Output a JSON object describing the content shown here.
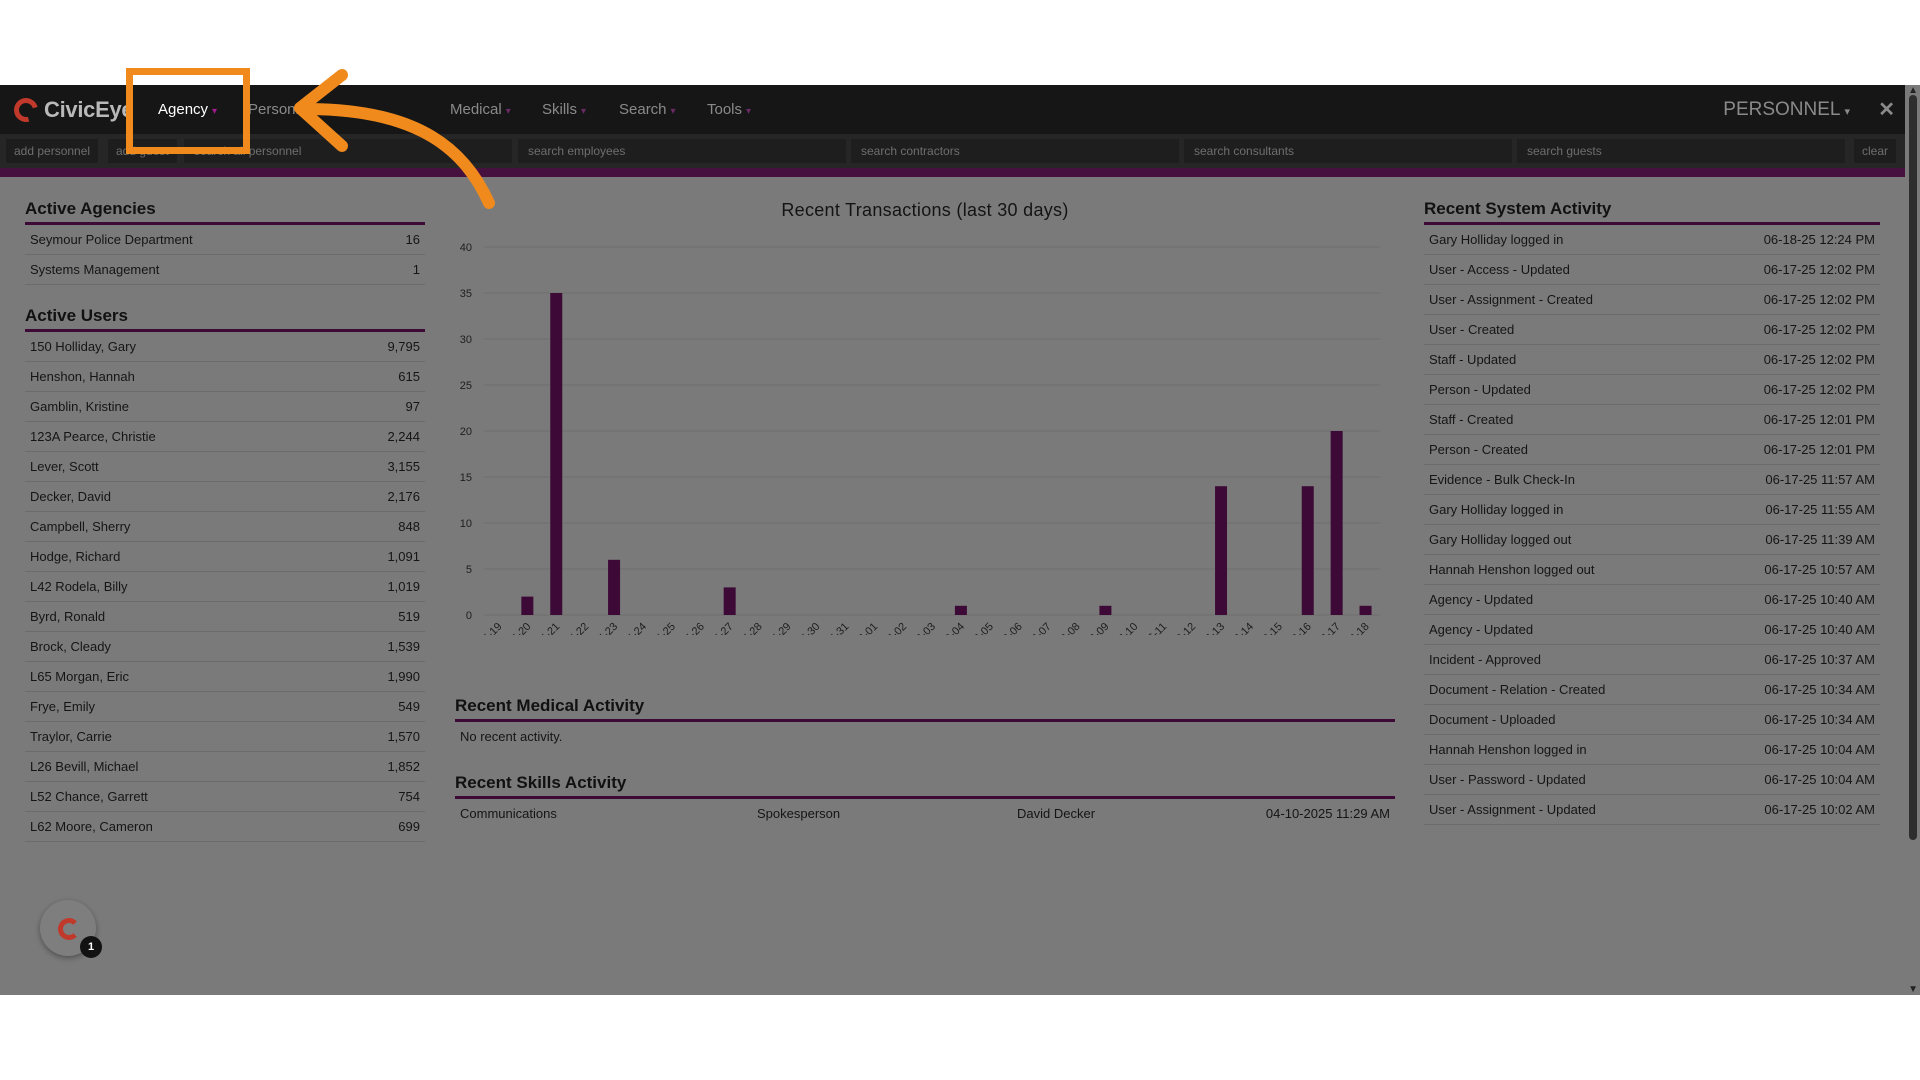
{
  "nav": {
    "brand": "CivicEye",
    "menus": [
      "Agency",
      "Personnel",
      "Medical",
      "Skills",
      "Search",
      "Tools"
    ],
    "persona": "PERSONNEL"
  },
  "searchbar": {
    "add_personnel": "add personnel",
    "add_guest": "add guest",
    "fields": [
      "search all personnel",
      "search employees",
      "search contractors",
      "search consultants",
      "search guests"
    ],
    "clear": "clear"
  },
  "active_agencies": {
    "title": "Active Agencies",
    "rows": [
      {
        "name": "Seymour Police Department",
        "count": "16"
      },
      {
        "name": "Systems Management",
        "count": "1"
      }
    ]
  },
  "active_users": {
    "title": "Active Users",
    "rows": [
      {
        "name": "150 Holliday, Gary",
        "count": "9,795"
      },
      {
        "name": "Henshon, Hannah",
        "count": "615"
      },
      {
        "name": "Gamblin, Kristine",
        "count": "97"
      },
      {
        "name": "123A Pearce, Christie",
        "count": "2,244"
      },
      {
        "name": "Lever, Scott",
        "count": "3,155"
      },
      {
        "name": "Decker, David",
        "count": "2,176"
      },
      {
        "name": "Campbell, Sherry",
        "count": "848"
      },
      {
        "name": "Hodge, Richard",
        "count": "1,091"
      },
      {
        "name": "L42 Rodela, Billy",
        "count": "1,019"
      },
      {
        "name": "Byrd, Ronald",
        "count": "519"
      },
      {
        "name": "Brock, Cleady",
        "count": "1,539"
      },
      {
        "name": "L65 Morgan, Eric",
        "count": "1,990"
      },
      {
        "name": "Frye, Emily",
        "count": "549"
      },
      {
        "name": "Traylor, Carrie",
        "count": "1,570"
      },
      {
        "name": "L26 Bevill, Michael",
        "count": "1,852"
      },
      {
        "name": "L52 Chance, Garrett",
        "count": "754"
      },
      {
        "name": "L62 Moore, Cameron",
        "count": "699"
      }
    ]
  },
  "chart_data": {
    "type": "bar",
    "title": "Recent Transactions (last 30 days)",
    "categories": [
      "05-19",
      "05-20",
      "05-21",
      "05-22",
      "05-23",
      "05-24",
      "05-25",
      "05-26",
      "05-27",
      "05-28",
      "05-29",
      "05-30",
      "05-31",
      "06-01",
      "06-02",
      "06-03",
      "06-04",
      "06-05",
      "06-06",
      "06-07",
      "06-08",
      "06-09",
      "06-10",
      "06-11",
      "06-12",
      "06-13",
      "06-14",
      "06-15",
      "06-16",
      "06-17",
      "06-18"
    ],
    "values": [
      0,
      2,
      35,
      0,
      6,
      0,
      0,
      0,
      3,
      0,
      0,
      0,
      0,
      0,
      0,
      0,
      1,
      0,
      0,
      0,
      0,
      1,
      0,
      0,
      0,
      14,
      0,
      0,
      14,
      20,
      1
    ],
    "yticks": [
      0,
      5,
      10,
      15,
      20,
      25,
      30,
      35,
      40
    ],
    "ylim": [
      0,
      40
    ],
    "grid": true,
    "bar_color": "#3d0a37"
  },
  "medical": {
    "title": "Recent Medical Activity",
    "empty": "No recent activity."
  },
  "skills": {
    "title": "Recent Skills Activity",
    "rows": [
      {
        "skill": "Communications",
        "role": "Spokesperson",
        "person": "David Decker",
        "date": "04-10-2025 11:29 AM"
      }
    ]
  },
  "system_activity": {
    "title": "Recent System Activity",
    "rows": [
      {
        "event": "Gary Holliday logged in",
        "time": "06-18-25 12:24 PM"
      },
      {
        "event": "User - Access - Updated",
        "time": "06-17-25 12:02 PM"
      },
      {
        "event": "User - Assignment - Created",
        "time": "06-17-25 12:02 PM"
      },
      {
        "event": "User - Created",
        "time": "06-17-25 12:02 PM"
      },
      {
        "event": "Staff - Updated",
        "time": "06-17-25 12:02 PM"
      },
      {
        "event": "Person - Updated",
        "time": "06-17-25 12:02 PM"
      },
      {
        "event": "Staff - Created",
        "time": "06-17-25 12:01 PM"
      },
      {
        "event": "Person - Created",
        "time": "06-17-25 12:01 PM"
      },
      {
        "event": "Evidence - Bulk Check-In",
        "time": "06-17-25 11:57 AM"
      },
      {
        "event": "Gary Holliday logged in",
        "time": "06-17-25 11:55 AM"
      },
      {
        "event": "Gary Holliday logged out",
        "time": "06-17-25 11:39 AM"
      },
      {
        "event": "Hannah Henshon logged out",
        "time": "06-17-25 10:57 AM"
      },
      {
        "event": "Agency - Updated",
        "time": "06-17-25 10:40 AM"
      },
      {
        "event": "Agency - Updated",
        "time": "06-17-25 10:40 AM"
      },
      {
        "event": "Incident - Approved",
        "time": "06-17-25 10:37 AM"
      },
      {
        "event": "Document - Relation - Created",
        "time": "06-17-25 10:34 AM"
      },
      {
        "event": "Document - Uploaded",
        "time": "06-17-25 10:34 AM"
      },
      {
        "event": "Hannah Henshon logged in",
        "time": "06-17-25 10:04 AM"
      },
      {
        "event": "User - Password - Updated",
        "time": "06-17-25 10:04 AM"
      },
      {
        "event": "User - Assignment - Updated",
        "time": "06-17-25 10:02 AM"
      }
    ]
  },
  "notification_count": "1",
  "colors": {
    "accent": "#46103f",
    "highlight": "#f08a1c"
  }
}
